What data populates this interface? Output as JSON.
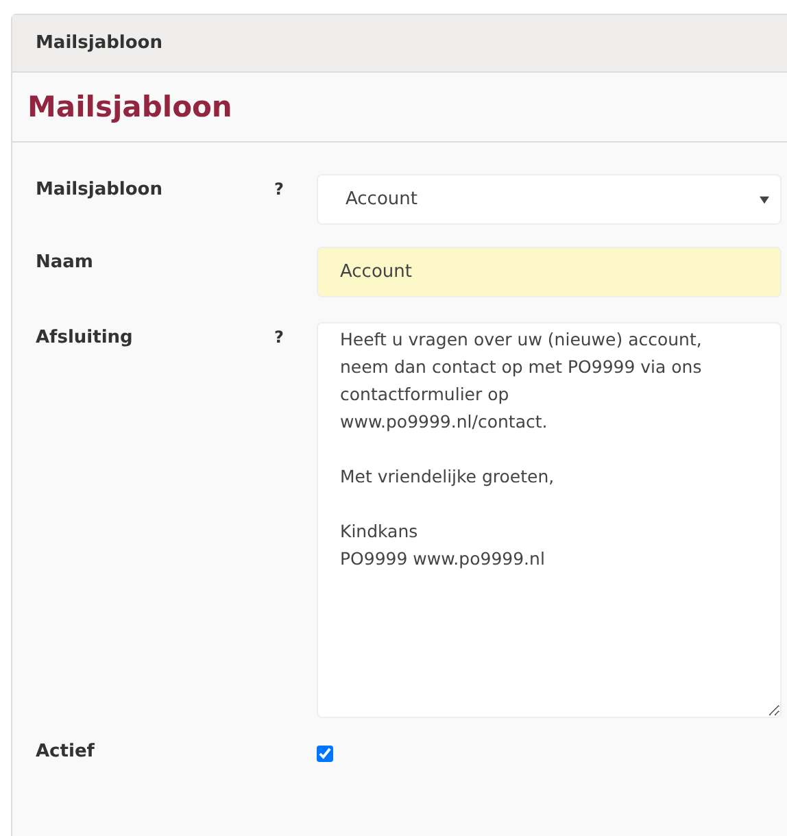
{
  "panel": {
    "title": "Mailsjabloon"
  },
  "heading": "Mailsjabloon",
  "fields": [
    {
      "kind": "select",
      "label": "Mailsjabloon",
      "help": "?",
      "value": "Account",
      "highlighted": false
    },
    {
      "kind": "text",
      "label": "Naam",
      "value": "Account",
      "highlighted": true
    },
    {
      "kind": "textarea",
      "label": "Afsluiting",
      "help": "?",
      "value": "Heeft u vragen over uw (nieuwe) account,\nneem dan contact op met PO9999 via ons\ncontactformulier op\nwww.po9999.nl/contact.\n\nMet vriendelijke groeten,\n\nKindkans\nPO9999 www.po9999.nl",
      "highlighted": false
    },
    {
      "kind": "checkbox",
      "label": "Actief",
      "checked": true
    }
  ]
}
